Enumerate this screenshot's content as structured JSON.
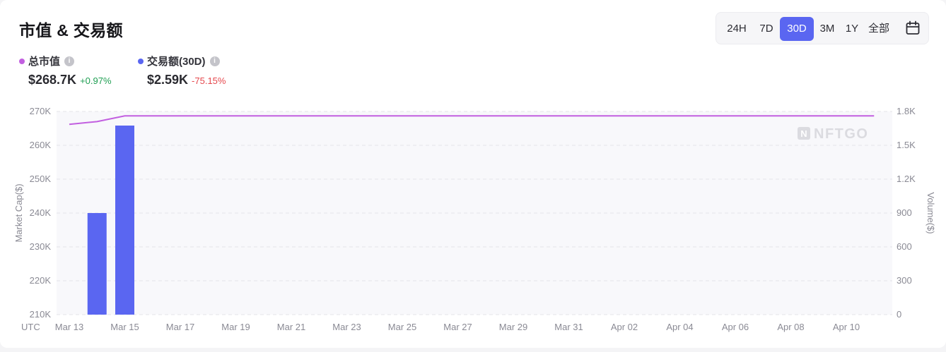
{
  "title": "市值 & 交易额",
  "ranges": [
    {
      "label": "24H",
      "active": false
    },
    {
      "label": "7D",
      "active": false
    },
    {
      "label": "30D",
      "active": true
    },
    {
      "label": "3M",
      "active": false
    },
    {
      "label": "1Y",
      "active": false
    },
    {
      "label": "全部",
      "active": false
    }
  ],
  "legend": {
    "market_cap": {
      "label": "总市值",
      "value": "$268.7K",
      "change": "+0.97%",
      "color": "#c25fe0"
    },
    "volume": {
      "label": "交易额(30D)",
      "value": "$2.59K",
      "change": "-75.15%",
      "color": "#5a66f1"
    }
  },
  "watermark": "NFTGO",
  "chart_data": {
    "type": "bar+line",
    "x_label_prefix": "UTC",
    "x_ticks": [
      "Mar 13",
      "Mar 15",
      "Mar 17",
      "Mar 19",
      "Mar 21",
      "Mar 23",
      "Mar 25",
      "Mar 27",
      "Mar 29",
      "Mar 31",
      "Apr 02",
      "Apr 04",
      "Apr 06",
      "Apr 08",
      "Apr 10"
    ],
    "left_axis": {
      "label": "Market Cap($)",
      "ticks": [
        "210K",
        "220K",
        "230K",
        "240K",
        "250K",
        "260K",
        "270K"
      ],
      "range": [
        210000,
        270000
      ]
    },
    "right_axis": {
      "label": "Volume($)",
      "ticks": [
        "0",
        "300",
        "600",
        "900",
        "1.2K",
        "1.5K",
        "1.8K"
      ],
      "range": [
        0,
        1800
      ]
    },
    "dates": [
      "Mar 13",
      "Mar 14",
      "Mar 15",
      "Mar 16",
      "Mar 17",
      "Mar 18",
      "Mar 19",
      "Mar 20",
      "Mar 21",
      "Mar 22",
      "Mar 23",
      "Mar 24",
      "Mar 25",
      "Mar 26",
      "Mar 27",
      "Mar 28",
      "Mar 29",
      "Mar 30",
      "Mar 31",
      "Apr 01",
      "Apr 02",
      "Apr 03",
      "Apr 04",
      "Apr 05",
      "Apr 06",
      "Apr 07",
      "Apr 08",
      "Apr 09",
      "Apr 10",
      "Apr 11"
    ],
    "series": [
      {
        "name": "总市值",
        "kind": "line",
        "axis": "left",
        "color": "#c25fe0",
        "values": [
          266200,
          267000,
          268700,
          268700,
          268700,
          268700,
          268700,
          268700,
          268700,
          268700,
          268700,
          268700,
          268700,
          268700,
          268700,
          268700,
          268700,
          268700,
          268700,
          268700,
          268700,
          268700,
          268700,
          268700,
          268700,
          268700,
          268700,
          268700,
          268700,
          268700
        ]
      },
      {
        "name": "交易额(30D)",
        "kind": "bar",
        "axis": "right",
        "color": "#5a66f1",
        "values": [
          0,
          900,
          1675,
          0,
          0,
          0,
          0,
          0,
          0,
          0,
          0,
          0,
          0,
          0,
          0,
          0,
          0,
          0,
          0,
          0,
          0,
          0,
          0,
          0,
          0,
          0,
          0,
          0,
          0,
          0
        ]
      }
    ],
    "grid": true
  }
}
